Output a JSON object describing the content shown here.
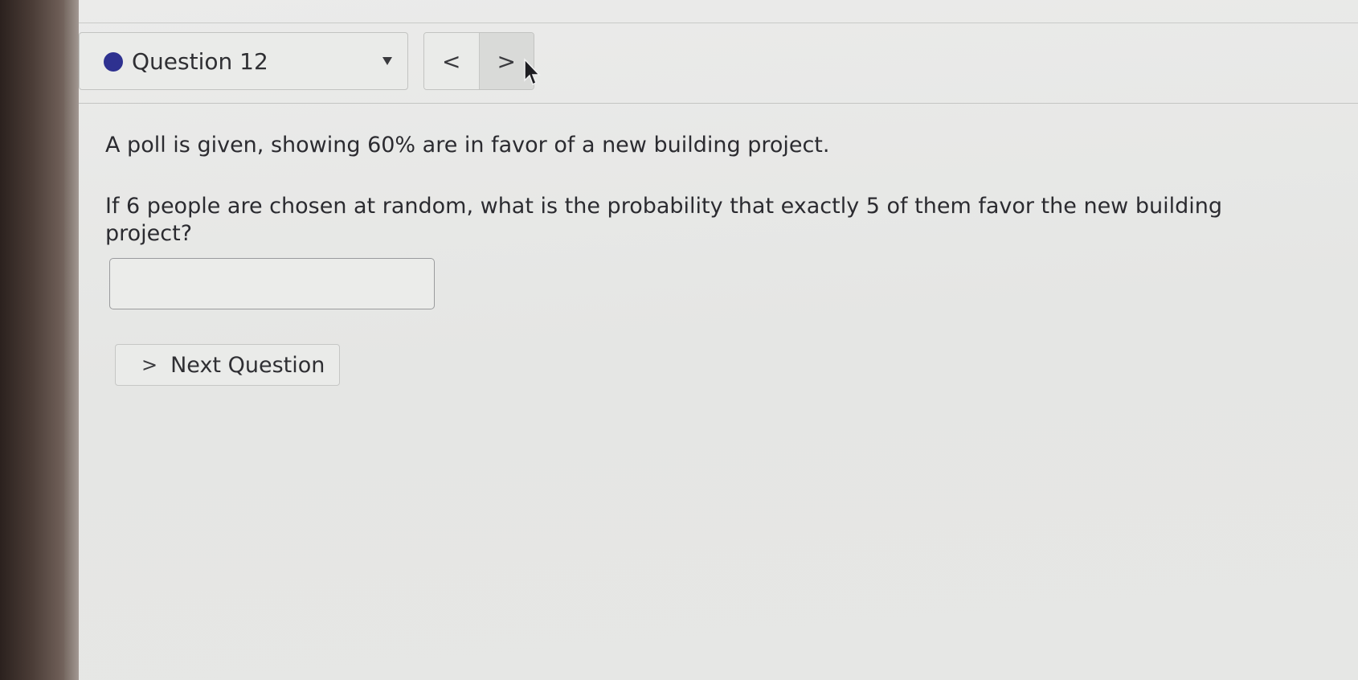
{
  "header": {
    "question_label": "Question 12",
    "status_color": "#2e3190",
    "dropdown_icon": "caret-down-icon",
    "prev_symbol": "<",
    "next_symbol": ">"
  },
  "question": {
    "line1": "A poll is given, showing 60% are in favor of a new building project.",
    "line2": "If 6 people are chosen at random, what is the probability that exactly 5 of them favor the new building",
    "line3": "project?"
  },
  "answer": {
    "value": "",
    "placeholder": ""
  },
  "footer": {
    "next_question_label": "Next Question",
    "next_question_icon": ">"
  }
}
